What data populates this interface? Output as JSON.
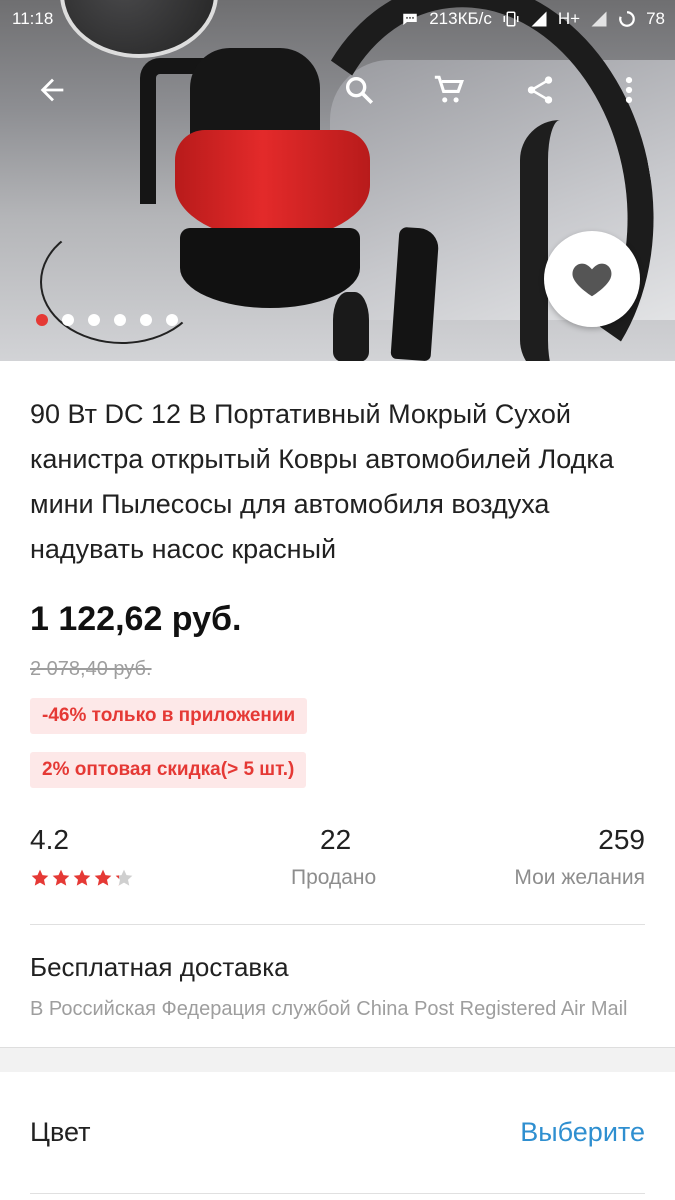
{
  "status_bar": {
    "time": "11:18",
    "network_speed": "213КБ/с",
    "network_type": "H+",
    "battery": "78"
  },
  "toolbar": {
    "back_icon": "arrow-left-icon",
    "search_icon": "search-icon",
    "cart_icon": "cart-icon",
    "share_icon": "share-icon",
    "more_icon": "more-vert-icon"
  },
  "gallery": {
    "total_images": 6,
    "active_index": 0
  },
  "product": {
    "title": "90 Вт DC 12 В Портативный Мокрый Сухой канистра открытый Ковры автомобилей Лодка мини Пылесосы для автомобиля воздуха надувать насос красный",
    "price": "1 122,62 руб.",
    "old_price": "2 078,40 руб.",
    "promo_app": "-46% только в приложении",
    "promo_wholesale": "2% оптовая скидка(> 5 шт.)"
  },
  "stats": {
    "rating": "4.2",
    "rating_stars": 4.2,
    "sold_count": "22",
    "sold_label": "Продано",
    "wishlist_count": "259",
    "wishlist_label": "Мои желания"
  },
  "shipping": {
    "title": "Бесплатная доставка",
    "subtitle": "В Российская Федерация службой China Post Registered Air Mail"
  },
  "options": {
    "color_label": "Цвет",
    "color_action": "Выберите"
  },
  "colors": {
    "accent_red": "#e53935",
    "link_blue": "#2f8fd0"
  }
}
